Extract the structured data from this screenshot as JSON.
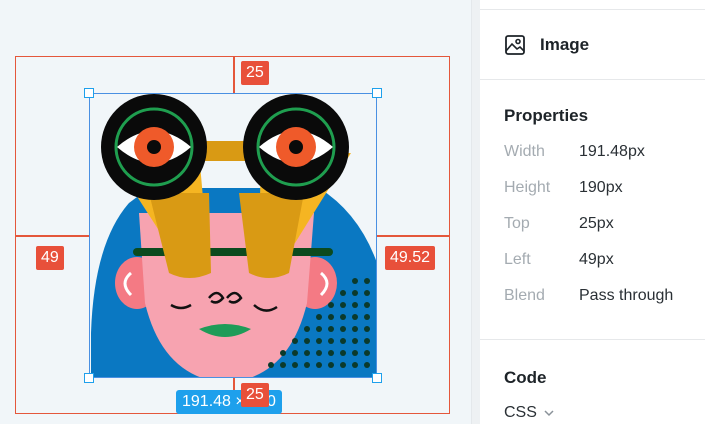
{
  "canvas": {
    "measure_top": "25",
    "measure_bottom": "25",
    "measure_left": "49",
    "measure_right": "49.52",
    "size_label": "191.48 × 190"
  },
  "panel": {
    "layer_type": "Image",
    "properties_title": "Properties",
    "properties": [
      {
        "key": "Width",
        "value": "191.48px"
      },
      {
        "key": "Height",
        "value": "190px"
      },
      {
        "key": "Top",
        "value": "25px"
      },
      {
        "key": "Left",
        "value": "49px"
      },
      {
        "key": "Blend",
        "value": "Pass through"
      }
    ],
    "code_title": "Code",
    "code_format": "CSS"
  },
  "colors": {
    "guide_red": "#e4573b",
    "selection_blue": "#1ea0ec"
  }
}
